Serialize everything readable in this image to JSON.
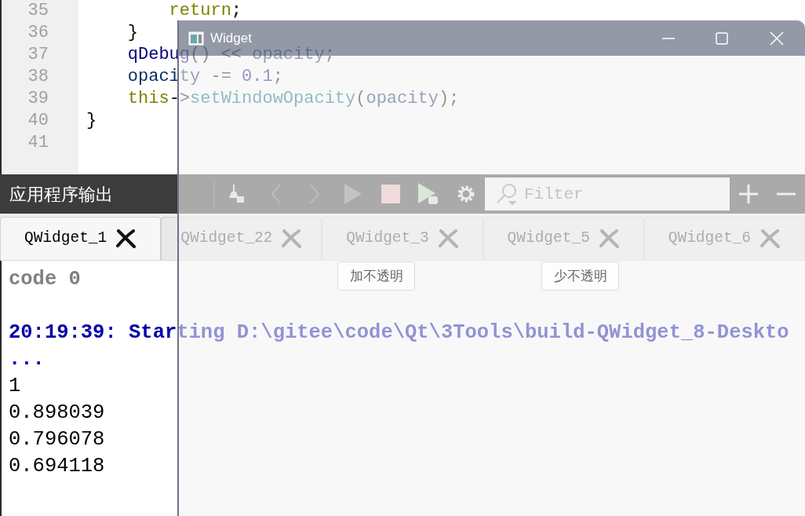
{
  "editor": {
    "lines": [
      {
        "number": "35",
        "tokens": [
          {
            "text": "        return",
            "kind": "keyword"
          },
          {
            "text": ";",
            "kind": "plain"
          }
        ]
      },
      {
        "number": "36",
        "tokens": [
          {
            "text": "    }",
            "kind": "plain"
          }
        ]
      },
      {
        "number": "37",
        "tokens": [
          {
            "text": "    qDebug",
            "kind": "type"
          },
          {
            "text": "() << ",
            "kind": "plain"
          },
          {
            "text": "opacity",
            "kind": "variable"
          },
          {
            "text": ";",
            "kind": "plain"
          }
        ]
      },
      {
        "number": "38",
        "tokens": [
          {
            "text": "    opacity",
            "kind": "variable"
          },
          {
            "text": " -= ",
            "kind": "plain"
          },
          {
            "text": "0.1",
            "kind": "number"
          },
          {
            "text": ";",
            "kind": "plain"
          }
        ]
      },
      {
        "number": "39",
        "tokens": [
          {
            "text": "    this",
            "kind": "keyword"
          },
          {
            "text": "->",
            "kind": "plain"
          },
          {
            "text": "setWindowOpacity",
            "kind": "function"
          },
          {
            "text": "(",
            "kind": "plain"
          },
          {
            "text": "opacity",
            "kind": "variable"
          },
          {
            "text": ");",
            "kind": "plain"
          }
        ]
      },
      {
        "number": "40",
        "tokens": [
          {
            "text": "}",
            "kind": "plain"
          }
        ]
      },
      {
        "number": "41"
      }
    ]
  },
  "output_pane": {
    "title": "应用程序输出",
    "filter": {
      "placeholder": "Filter"
    },
    "tabs": [
      {
        "label": "QWidget_1",
        "selected": true
      },
      {
        "label": "QWidget_22",
        "selected": false
      },
      {
        "label": "QWidget_3",
        "selected": false
      },
      {
        "label": "QWidget_5",
        "selected": false
      },
      {
        "label": "QWidget_6",
        "selected": false
      }
    ],
    "lines": [
      {
        "text": "code 0",
        "kind": "status"
      },
      {
        "text": "20:19:39: Starting D:\\gitee\\code\\Qt\\3Tools\\build-QWidget_8-Deskto",
        "kind": "start"
      },
      {
        "text": "...",
        "kind": "start"
      },
      {
        "text": "1",
        "kind": "stdout"
      },
      {
        "text": "0.898039",
        "kind": "stdout"
      },
      {
        "text": "0.796078",
        "kind": "stdout"
      },
      {
        "text": "0.694118",
        "kind": "stdout"
      }
    ]
  },
  "widget_window": {
    "title": "Widget",
    "buttons": [
      "加不透明",
      "少不透明"
    ]
  }
}
